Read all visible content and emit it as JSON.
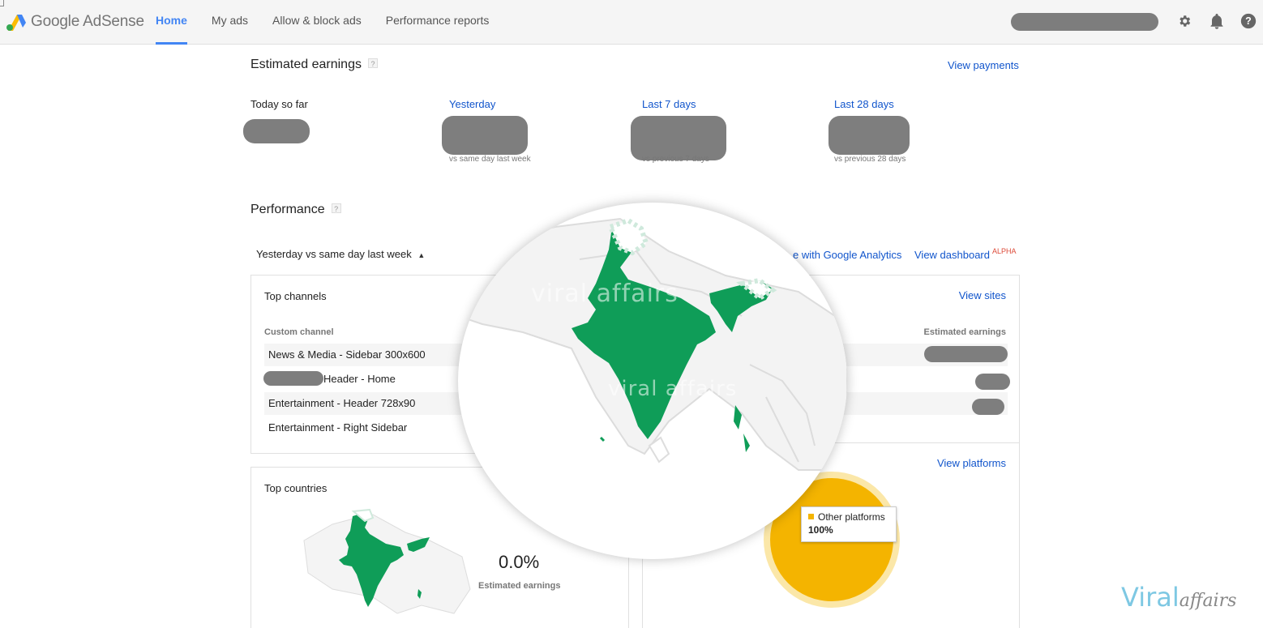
{
  "app": {
    "name": "Google AdSense"
  },
  "nav": {
    "items": [
      {
        "label": "Home",
        "active": true
      },
      {
        "label": "My ads"
      },
      {
        "label": "Allow & block ads"
      },
      {
        "label": "Performance reports"
      }
    ]
  },
  "icons": {
    "settings": "gear-icon",
    "notifications": "bell-icon",
    "help": "help-icon"
  },
  "colors": {
    "accent": "#4285f4",
    "link": "#1155cc",
    "map_green": "#0f9d58",
    "pie_yellow": "#f4b400"
  },
  "earnings": {
    "title": "Estimated earnings",
    "help": "?",
    "view_payments": "View payments",
    "periods": [
      {
        "label": "Today so far"
      },
      {
        "label": "Yesterday",
        "compare": "vs same day last week"
      },
      {
        "label": "Last 7 days",
        "compare": "vs previous 7 days"
      },
      {
        "label": "Last 28 days",
        "compare": "vs previous 28 days"
      }
    ]
  },
  "performance": {
    "title": "Performance",
    "help": "?",
    "range": "Yesterday vs same day last week",
    "analytics_link": "e with Google Analytics",
    "dashboard_link": "View dashboard",
    "alpha": "ALPHA"
  },
  "top_channels": {
    "title": "Top channels",
    "view_sites": "View sites",
    "col_channel": "Custom channel",
    "col_earnings": "Estimated earnings",
    "rows": [
      {
        "name": "News & Media - Sidebar 300x600"
      },
      {
        "name": "Header - Home"
      },
      {
        "name": "Entertainment - Header 728x90"
      },
      {
        "name": "Entertainment - Right Sidebar"
      }
    ]
  },
  "top_countries": {
    "title": "Top countries",
    "value": "0.0%",
    "value_label": "Estimated earnings"
  },
  "platforms": {
    "view_platforms": "View platforms",
    "tooltip_label": "Other platforms",
    "tooltip_value": "100%"
  },
  "chart_data": {
    "type": "pie",
    "categories": [
      "Other platforms"
    ],
    "values": [
      100
    ]
  },
  "watermark": {
    "text": "viral affairs"
  },
  "brand": {
    "primary": "Viral",
    "secondary": "affairs"
  }
}
